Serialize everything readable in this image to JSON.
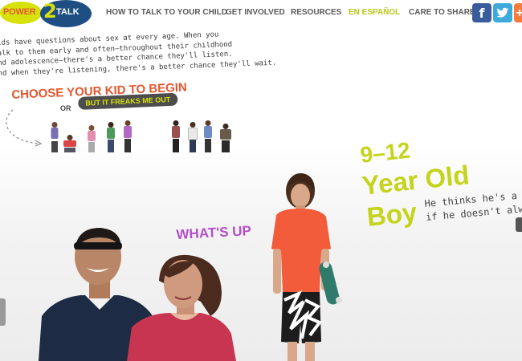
{
  "header": {
    "logo": {
      "word1": "POWER",
      "two": "2",
      "word2": "TALK"
    },
    "nav": [
      {
        "label": "HOW TO TALK TO YOUR CHILD"
      },
      {
        "label": "GET INVOLVED"
      },
      {
        "label": "RESOURCES"
      },
      {
        "label": "EN ESPAÑOL"
      }
    ],
    "share_label": "CARE TO SHARE:",
    "social": [
      {
        "icon": "facebook-icon",
        "glyph": "f"
      },
      {
        "icon": "twitter-icon",
        "glyph": "t"
      },
      {
        "icon": "plus-icon",
        "glyph": "+"
      }
    ]
  },
  "intro": {
    "lines": [
      "ids have questions about sex at every age. When you",
      "alk to them early and often—throughout their childhood",
      "nd adolescence—there's a better chance they'll listen.",
      "nd when they're listening, there's a better chance they'll wait."
    ],
    "choose_title": "CHOOSE YOUR KID TO BEGIN",
    "or_text": "OR",
    "freak_button": "BUT IT FREAKS ME OUT"
  },
  "profile": {
    "age_lines": [
      "9–12",
      "Year Old",
      "Boy"
    ],
    "tagline_lines": [
      "He thinks he's a coo",
      "if he doesn't always"
    ],
    "whats_up": "WHAT'S UP"
  },
  "colors": {
    "accent_orange": "#e4572e",
    "accent_lime": "#c4d41c",
    "accent_purple": "#b24fc7",
    "logo_blue": "#1f4f82"
  }
}
